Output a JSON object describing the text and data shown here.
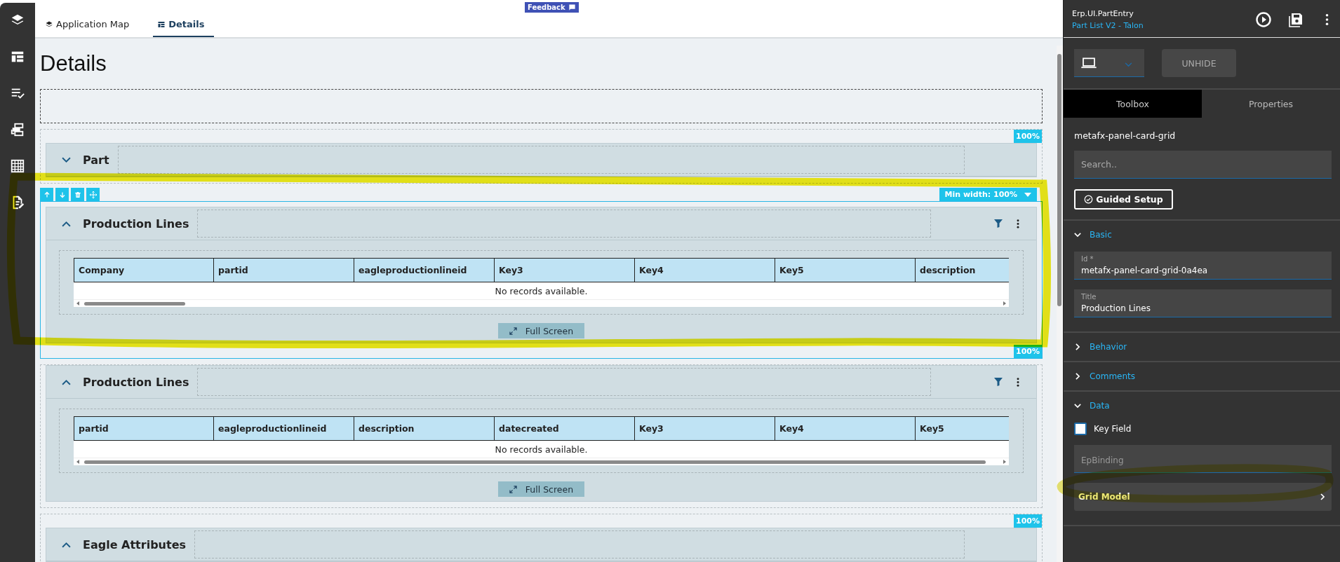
{
  "tabs": [
    {
      "label": "Application Map",
      "kind": "layers",
      "selected": false
    },
    {
      "label": "Details",
      "kind": "grid",
      "selected": true
    }
  ],
  "feedback": "Feedback",
  "page_title": "Details",
  "panels": [
    {
      "title": "Part",
      "expanded": false,
      "selected": false,
      "badge": "100%"
    },
    {
      "title": "Production Lines",
      "expanded": true,
      "selected": true,
      "badge": "100%",
      "min_width": "Min width: 100%",
      "columns": [
        "Company",
        "partid",
        "eagleproductionlineid",
        "Key3",
        "Key4",
        "Key5",
        "description"
      ],
      "empty_text": "No records available.",
      "full_screen": "Full Screen"
    },
    {
      "title": "Production Lines",
      "expanded": true,
      "selected": false,
      "columns": [
        "partid",
        "eagleproductionlineid",
        "description",
        "datecreated",
        "Key3",
        "Key4",
        "Key5"
      ],
      "empty_text": "No records available.",
      "full_screen": "Full Screen"
    },
    {
      "title": "Eagle Attributes",
      "expanded": true,
      "selected": false,
      "badge": "100%"
    }
  ],
  "designer": {
    "app": "Erp.UI.PartEntry",
    "layer": "Part List V2 - Talon",
    "unhide": "UNHIDE",
    "tabs": [
      {
        "label": "Toolbox",
        "selected": true
      },
      {
        "label": "Properties",
        "selected": false
      }
    ],
    "component": "metafx-panel-card-grid",
    "search": {
      "placeholder": "Search.."
    },
    "guided_setup": "Guided Setup",
    "sections": [
      {
        "title": "Basic",
        "expanded": true,
        "fields": [
          {
            "kind": "text",
            "label": "Id *",
            "value": "metafx-panel-card-grid-0a4ea"
          },
          {
            "kind": "text",
            "label": "Title",
            "value": "Production Lines"
          }
        ]
      },
      {
        "title": "Behavior",
        "expanded": false
      },
      {
        "title": "Comments",
        "expanded": false
      },
      {
        "title": "Data",
        "expanded": true,
        "fields": [
          {
            "kind": "checkbox",
            "label": "Key Field",
            "checked": false
          },
          {
            "kind": "text",
            "placeholder": "EpBinding"
          },
          {
            "kind": "link",
            "label": "Grid Model"
          }
        ]
      }
    ]
  }
}
